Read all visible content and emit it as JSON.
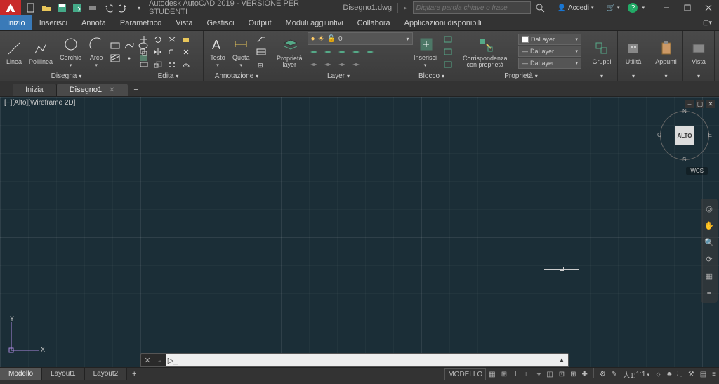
{
  "title": {
    "app": "Autodesk AutoCAD 2019 - VERSIONE PER STUDENTI",
    "file": "Disegno1.dwg",
    "search_placeholder": "Digitare parola chiave o frase",
    "signin": "Accedi"
  },
  "ribbon_tabs": [
    "Inizio",
    "Inserisci",
    "Annota",
    "Parametrico",
    "Vista",
    "Gestisci",
    "Output",
    "Moduli aggiuntivi",
    "Collabora",
    "Applicazioni disponibili"
  ],
  "active_ribbon_tab": "Inizio",
  "panels": {
    "disegna": {
      "title": "Disegna",
      "btns": {
        "linea": "Linea",
        "polilinea": "Polilinea",
        "cerchio": "Cerchio",
        "arco": "Arco"
      }
    },
    "edita": {
      "title": "Edita"
    },
    "annotazione": {
      "title": "Annotazione",
      "btns": {
        "testo": "Testo",
        "quota": "Quota"
      }
    },
    "layer": {
      "title": "Layer",
      "btns": {
        "proprieta": "Proprietà\nlayer"
      },
      "combo": "0"
    },
    "blocco": {
      "title": "Blocco",
      "btns": {
        "inserisci": "Inserisci"
      }
    },
    "proprieta": {
      "title": "Proprietà",
      "btns": {
        "corr": "Corrispondenza\ncon proprietà"
      },
      "rows": [
        "DaLayer",
        "DaLayer",
        "DaLayer"
      ]
    },
    "gruppi": {
      "title": "",
      "btn": "Gruppi"
    },
    "utilita": {
      "title": "",
      "btn": "Utilità"
    },
    "appunti": {
      "title": "",
      "btn": "Appunti"
    },
    "vista": {
      "title": "",
      "btn": "Vista"
    }
  },
  "file_tabs": {
    "items": [
      "Inizia",
      "Disegno1"
    ],
    "active": "Disegno1"
  },
  "viewport": {
    "label": "[−][Alto][Wireframe 2D]",
    "cube": "ALTO",
    "dirs": {
      "n": "N",
      "s": "S",
      "e": "E",
      "o": "O"
    },
    "wcs": "WCS",
    "ucs": {
      "y": "Y",
      "x": "X"
    }
  },
  "cmdline": {
    "value": ""
  },
  "model_tabs": {
    "items": [
      "Modello",
      "Layout1",
      "Layout2"
    ],
    "active": "Modello"
  },
  "status": {
    "model": "MODELLO",
    "scale": "1:1",
    "anno_items": [
      "▦",
      "⊞",
      "⊥",
      "∟",
      "⌖",
      "◫",
      "⊡",
      "⊞",
      "✚"
    ],
    "right_items": [
      "⚙",
      "✎",
      "人1:",
      "☼",
      "♣",
      "⛶",
      "⚒",
      "▤",
      "≡"
    ]
  }
}
